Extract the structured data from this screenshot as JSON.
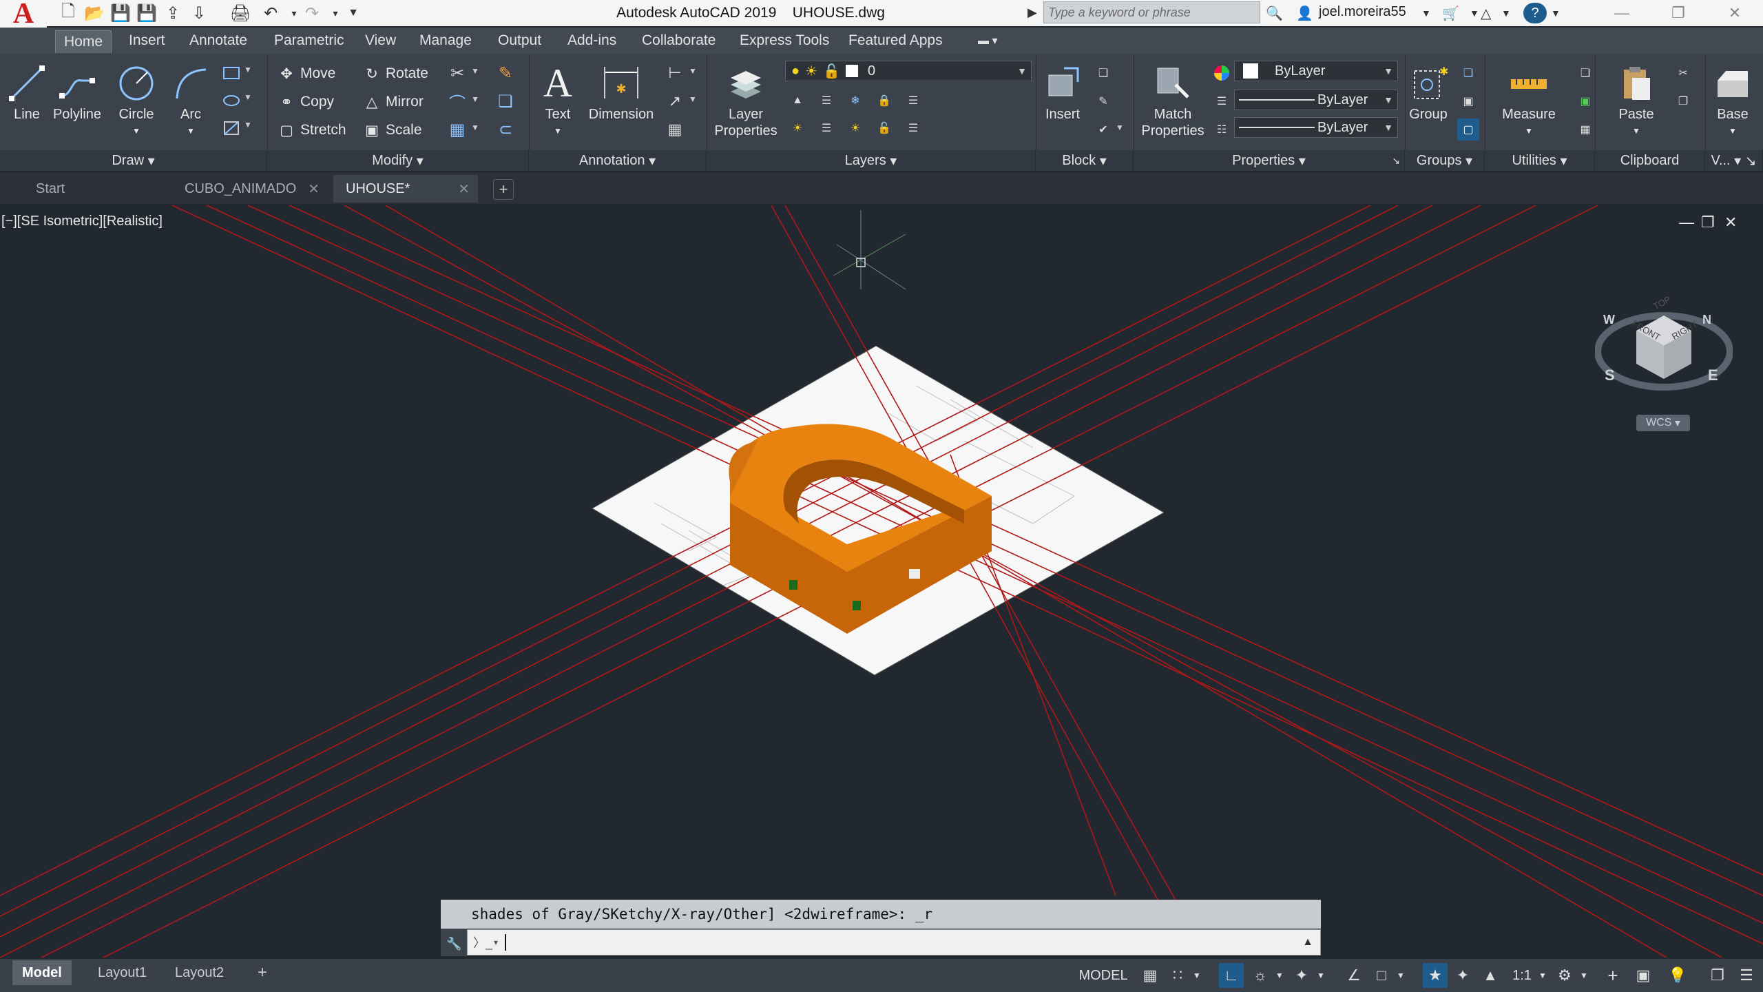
{
  "title_bar": {
    "app_name": "Autodesk AutoCAD 2019",
    "file_name": "UHOUSE.dwg",
    "search_placeholder": "Type a keyword or phrase",
    "username": "joel.moreira55",
    "logo_letter": "A"
  },
  "ribbon_tabs": [
    "Home",
    "Insert",
    "Annotate",
    "Parametric",
    "View",
    "Manage",
    "Output",
    "Add-ins",
    "Collaborate",
    "Express Tools",
    "Featured Apps"
  ],
  "active_ribbon_tab": "Home",
  "ribbon": {
    "draw": {
      "label": "Draw",
      "line": "Line",
      "polyline": "Polyline",
      "circle": "Circle",
      "arc": "Arc"
    },
    "modify": {
      "label": "Modify",
      "move": "Move",
      "rotate": "Rotate",
      "copy": "Copy",
      "mirror": "Mirror",
      "stretch": "Stretch",
      "scale": "Scale"
    },
    "annotation": {
      "label": "Annotation",
      "text": "Text",
      "dimension": "Dimension"
    },
    "layers": {
      "label": "Layers",
      "layer_properties": "Layer\nProperties",
      "current_layer": "0"
    },
    "block": {
      "label": "Block",
      "insert": "Insert"
    },
    "properties": {
      "label": "Properties",
      "match_properties": "Match\nProperties",
      "color": "ByLayer",
      "linetype": "ByLayer",
      "lineweight": "ByLayer"
    },
    "groups": {
      "label": "Groups",
      "group": "Group"
    },
    "utilities": {
      "label": "Utilities",
      "measure": "Measure"
    },
    "clipboard": {
      "label": "Clipboard",
      "paste": "Paste"
    },
    "view": {
      "label": "V...",
      "base": "Base"
    }
  },
  "doc_tabs": [
    {
      "label": "Start",
      "active": false
    },
    {
      "label": "CUBO_ANIMADO",
      "active": false
    },
    {
      "label": "UHOUSE*",
      "active": true
    }
  ],
  "viewport": {
    "label": "[−][SE Isometric][Realistic]",
    "viewcube": {
      "top": "TOP",
      "front": "FRONT",
      "right": "RIGHT",
      "n": "N",
      "s": "S",
      "e": "E",
      "w": "W"
    },
    "ucs_label": "WCS"
  },
  "command_line": {
    "history": "shades of Gray/SKetchy/X-ray/Other] <2dwireframe>: _r",
    "input": ""
  },
  "layout_tabs": [
    {
      "label": "Model",
      "active": true
    },
    {
      "label": "Layout1",
      "active": false
    },
    {
      "label": "Layout2",
      "active": false
    }
  ],
  "status_bar": {
    "model": "MODEL",
    "scale": "1:1"
  },
  "colors": {
    "model_orange": "#e07a10",
    "construction_lines": "#b01818",
    "viewport_bg": "#212830"
  }
}
